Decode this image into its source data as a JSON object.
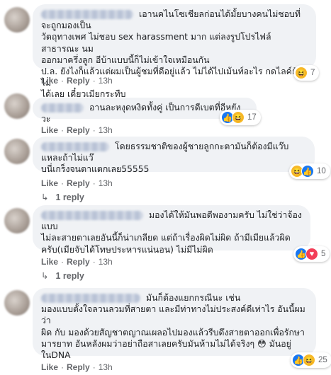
{
  "actions": {
    "like": "Like",
    "reply": "Reply",
    "sep": "·"
  },
  "comments": [
    {
      "text": "เอานคไนโซเชียลก่อนได้มั้ยบางคนไม่ชอบที่จะถูกมองเป็น\nวัตถุทางเพศ ไม่ชอบ sex harassment มาก แต่ลงรูปโปรไฟล์สาธารณะ นม\nออกมาครึ่งลูก อีบ้าแบบนี้ก็ไม่เข้าใจเหมือนกัน\nป.ล. ยังไงก็แล้วแต่ผมเป็นผู้ชมที่ดีอยู่แล้ว ไม่ได้ไปเม้นท์อะไร กดไลค์ยังไม่\nได้เลย เดี๋ยวเมียกระทืบ",
      "time": "13h",
      "reactions": [
        "haha"
      ],
      "count": "7"
    },
    {
      "text": "อานละหงุดหงิดทั้งคู่ เป็นการดีเบตที่อีหยังวะ",
      "time": "13h",
      "reactions": [
        "like",
        "haha"
      ],
      "count": "17"
    },
    {
      "text": "โดยธรรมชาติของผู้ชายลูกกะตามันก็ต้องมีแว๊บแหละถ้าไม่แว๊\nบนี่เกร็งจนตาแตกเลย55555",
      "time": "13h",
      "reactions": [
        "haha",
        "like"
      ],
      "count": "10",
      "reply_label": "1 reply"
    },
    {
      "text": "มองได้ให้มันพอดีพองามครับ ไม่ใช่ว่าจ้องแบบ\nไม่ละสายตาเลยอันนี้ก็น่าเกลียด แต่ถ้าเรื่องผิดไม่ผิด ถ้ามีเมียแล้วผิด\nครับ(เมียจับได้โทษประหารแน่นอน) ไม่มีไม่ผิด",
      "time": "13h",
      "reactions": [
        "like",
        "love"
      ],
      "count": "5",
      "reply_label": "1 reply"
    },
    {
      "text": "มันก็ต้องแยกกรณีนะ เช่น\nมองแบบตั้งใจลวนลวมที่สายตา และมีท่าทางไม่ประสงค์ดีเท่าไร อันนี้ผมว่า\nผิด กับ มองด้วยสัญชาตญาณเผลอไปมองแล้วรีบดึงสายตาออกเพื่อรักษา\nมารยาท อันหลังผมว่าอย่าถือสาเลยครับมันห้ามไม่ได้จริงๆ 😳 มันอยู่\nในDNA",
      "time": "13h",
      "reactions": [
        "like",
        "haha"
      ],
      "count": "25"
    }
  ]
}
